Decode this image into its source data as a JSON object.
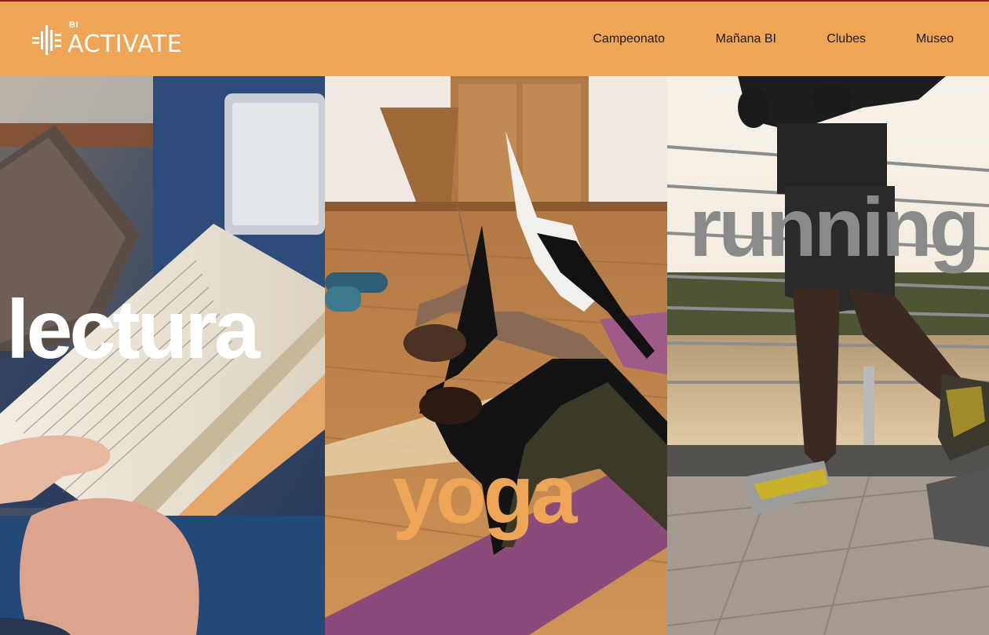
{
  "brand": {
    "small": "BI",
    "name": "ACTIVATE",
    "accent": "#efa556",
    "topline": "#8f1f13"
  },
  "nav": {
    "items": [
      {
        "label": "Campeonato"
      },
      {
        "label": "Mañana BI"
      },
      {
        "label": "Clubes"
      },
      {
        "label": "Museo"
      }
    ]
  },
  "panels": [
    {
      "word": "lectura",
      "color": "#ffffff",
      "image": "reading-book-photo"
    },
    {
      "word": "yoga",
      "color": "#efa556",
      "image": "yoga-class-photo"
    },
    {
      "word": "running",
      "color": "#8a8a8a",
      "image": "running-waterfront-photo"
    }
  ]
}
